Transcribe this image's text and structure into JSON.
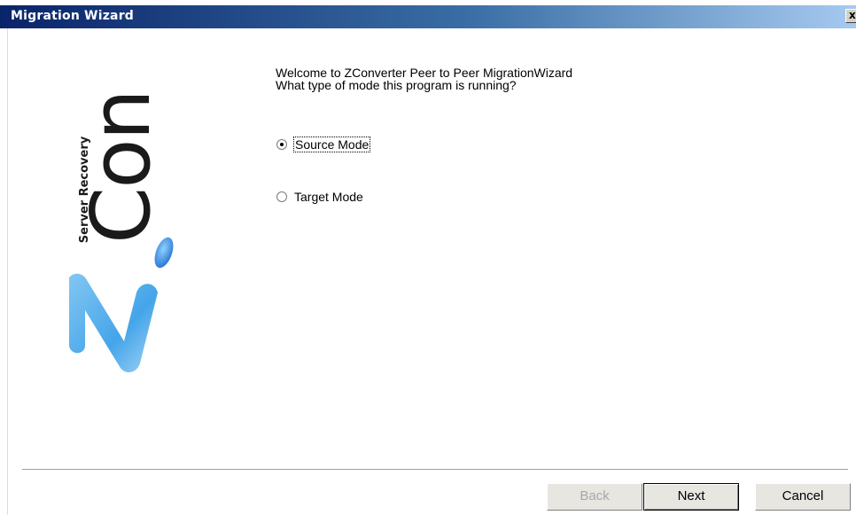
{
  "window": {
    "title": "Migration Wizard",
    "close_glyph": "x"
  },
  "logo": {
    "brand_word": "Con",
    "tagline": "Server Recovery",
    "letter": "Z-i logo mark",
    "colors": {
      "word": "#1a1a1a",
      "mark": "#3aa0e8",
      "dot": "#1e7fd6"
    }
  },
  "intro": {
    "line1": "Welcome to ZConverter Peer to Peer MigrationWizard",
    "line2": "What type of mode this program is running?"
  },
  "modes": [
    {
      "label": "Source Mode",
      "selected": true
    },
    {
      "label": "Target Mode",
      "selected": false
    }
  ],
  "buttons": {
    "back": "Back",
    "next": "Next",
    "cancel": "Cancel"
  }
}
